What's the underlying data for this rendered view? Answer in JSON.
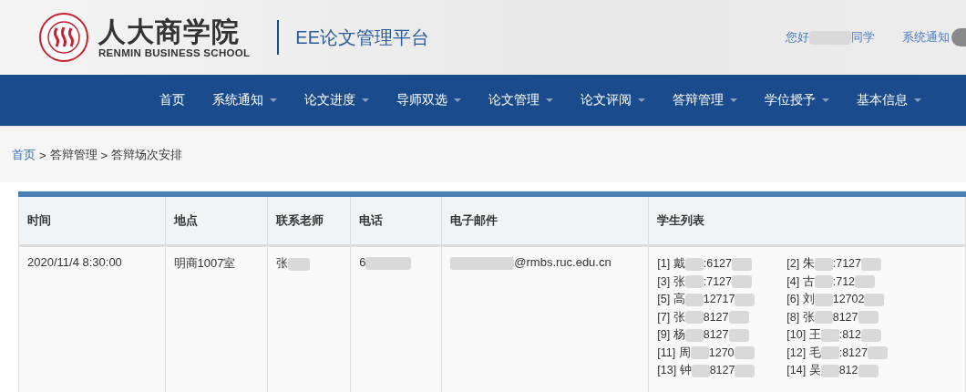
{
  "header": {
    "brand_cn": "人大商学院",
    "brand_en": "RENMIN BUSINESS SCHOOL",
    "platform": "EE论文管理平台",
    "greeting_before": "您好",
    "greeting_after": "同学",
    "notice": "系统通知"
  },
  "nav": [
    {
      "label": "首页",
      "dropdown": false
    },
    {
      "label": "系统通知",
      "dropdown": true
    },
    {
      "label": "论文进度",
      "dropdown": true
    },
    {
      "label": "导师双选",
      "dropdown": true
    },
    {
      "label": "论文管理",
      "dropdown": true
    },
    {
      "label": "论文评阅",
      "dropdown": true
    },
    {
      "label": "答辩管理",
      "dropdown": true
    },
    {
      "label": "学位授予",
      "dropdown": true
    },
    {
      "label": "基本信息",
      "dropdown": true
    }
  ],
  "breadcrumb_separator": ">",
  "breadcrumb": [
    {
      "label": "首页",
      "link": true
    },
    {
      "label": "答辩管理",
      "link": false
    },
    {
      "label": "答辩场次安排",
      "link": false
    }
  ],
  "table": {
    "columns": [
      "时间",
      "地点",
      "联系老师",
      "电话",
      "电子邮件",
      "学生列表"
    ],
    "rows": [
      {
        "time": "2020/11/4 8:30:00",
        "place": "明商1007室",
        "teacher": "张",
        "phone": "6",
        "email": "@rmbs.ruc.edu.cn",
        "students": [
          {
            "label": "[1] 戴",
            "id": ":6127"
          },
          {
            "label": "[2] 朱",
            "id": ":7127"
          },
          {
            "label": "[3] 张",
            "id": ":7127"
          },
          {
            "label": "[4] 古",
            "id": ":712"
          },
          {
            "label": "[5] 高",
            "id": "12717"
          },
          {
            "label": "[6] 刘",
            "id": "12702"
          },
          {
            "label": "[7] 张",
            "id": "8127"
          },
          {
            "label": "[8] 张",
            "id": "8127"
          },
          {
            "label": "[9] 杨",
            "id": "8127"
          },
          {
            "label": "[10] 王",
            "id": ":812"
          },
          {
            "label": "[11] 周",
            "id": "1270"
          },
          {
            "label": "[12] 毛",
            "id": ":8127"
          },
          {
            "label": "[13] 钟",
            "id": "8127"
          },
          {
            "label": "[14] 吴",
            "id": "812"
          }
        ]
      }
    ]
  }
}
